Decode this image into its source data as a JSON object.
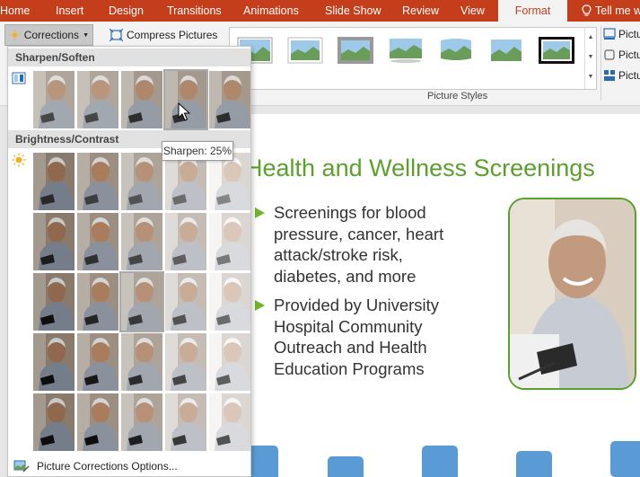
{
  "tabs": {
    "home": "Home",
    "insert": "Insert",
    "design": "Design",
    "transitions": "Transitions",
    "animations": "Animations",
    "slide_show": "Slide Show",
    "review": "Review",
    "view": "View",
    "format": "Format",
    "tell_me": "Tell me w"
  },
  "ribbon": {
    "corrections": "Corrections",
    "compress": "Compress Pictures",
    "group_label": "Picture Styles",
    "right_items": [
      "Pictu",
      "Pictu",
      "Pictu"
    ]
  },
  "dropdown": {
    "sharpen_header": "Sharpen/Soften",
    "brightness_header": "Brightness/Contrast",
    "footer": "Picture Corrections Options...",
    "tooltip": "Sharpen: 25%"
  },
  "slide": {
    "title": "Health and Wellness Screenings",
    "bullets": [
      "Screenings for blood pressure, cancer, heart attack/stroke risk, diabetes, and more",
      "Provided by University Hospital Community Outreach and Health Education Programs"
    ]
  },
  "icons": {
    "sharpen_icon": "sharpen-icon",
    "brightness_icon": "sun-icon",
    "heart_icon": "heart-pulse-icon"
  },
  "colors": {
    "accent": "#c43e1c",
    "title_green": "#5aa02c",
    "bullet_green": "#6fb52c",
    "icon_blue": "#5b9bd5"
  }
}
